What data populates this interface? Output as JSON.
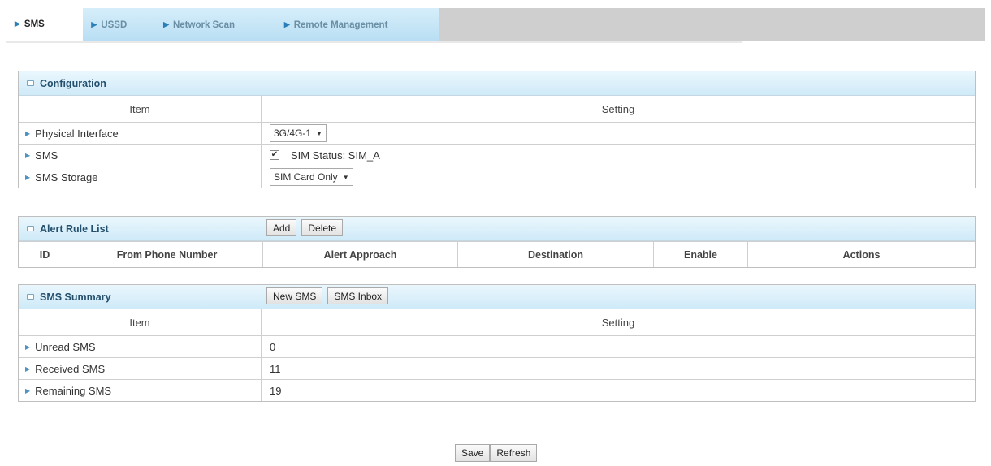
{
  "tabs": [
    {
      "label": "SMS",
      "active": true
    },
    {
      "label": "USSD",
      "active": false
    },
    {
      "label": "Network Scan",
      "active": false
    },
    {
      "label": "Remote Management",
      "active": false
    }
  ],
  "configuration": {
    "title": "Configuration",
    "col_item": "Item",
    "col_setting": "Setting",
    "rows": [
      {
        "label": "Physical Interface",
        "value": "3G/4G-1"
      },
      {
        "label": "SMS",
        "checked": true,
        "value": "SIM Status: SIM_A"
      },
      {
        "label": "SMS Storage",
        "value": "SIM Card Only"
      }
    ]
  },
  "alert_rules": {
    "title": "Alert Rule List",
    "add_label": "Add",
    "delete_label": "Delete",
    "columns": [
      "ID",
      "From Phone Number",
      "Alert Approach",
      "Destination",
      "Enable",
      "Actions"
    ]
  },
  "summary": {
    "title": "SMS Summary",
    "new_sms_label": "New SMS",
    "inbox_label": "SMS Inbox",
    "col_item": "Item",
    "col_setting": "Setting",
    "rows": [
      {
        "label": "Unread SMS",
        "value": "0"
      },
      {
        "label": "Received SMS",
        "value": "11"
      },
      {
        "label": "Remaining SMS",
        "value": "19"
      }
    ]
  },
  "footer": {
    "save_label": "Save",
    "refresh_label": "Refresh"
  },
  "colors": {
    "accent": "#2a7fb8",
    "header_bg": "#cfeaf8"
  }
}
